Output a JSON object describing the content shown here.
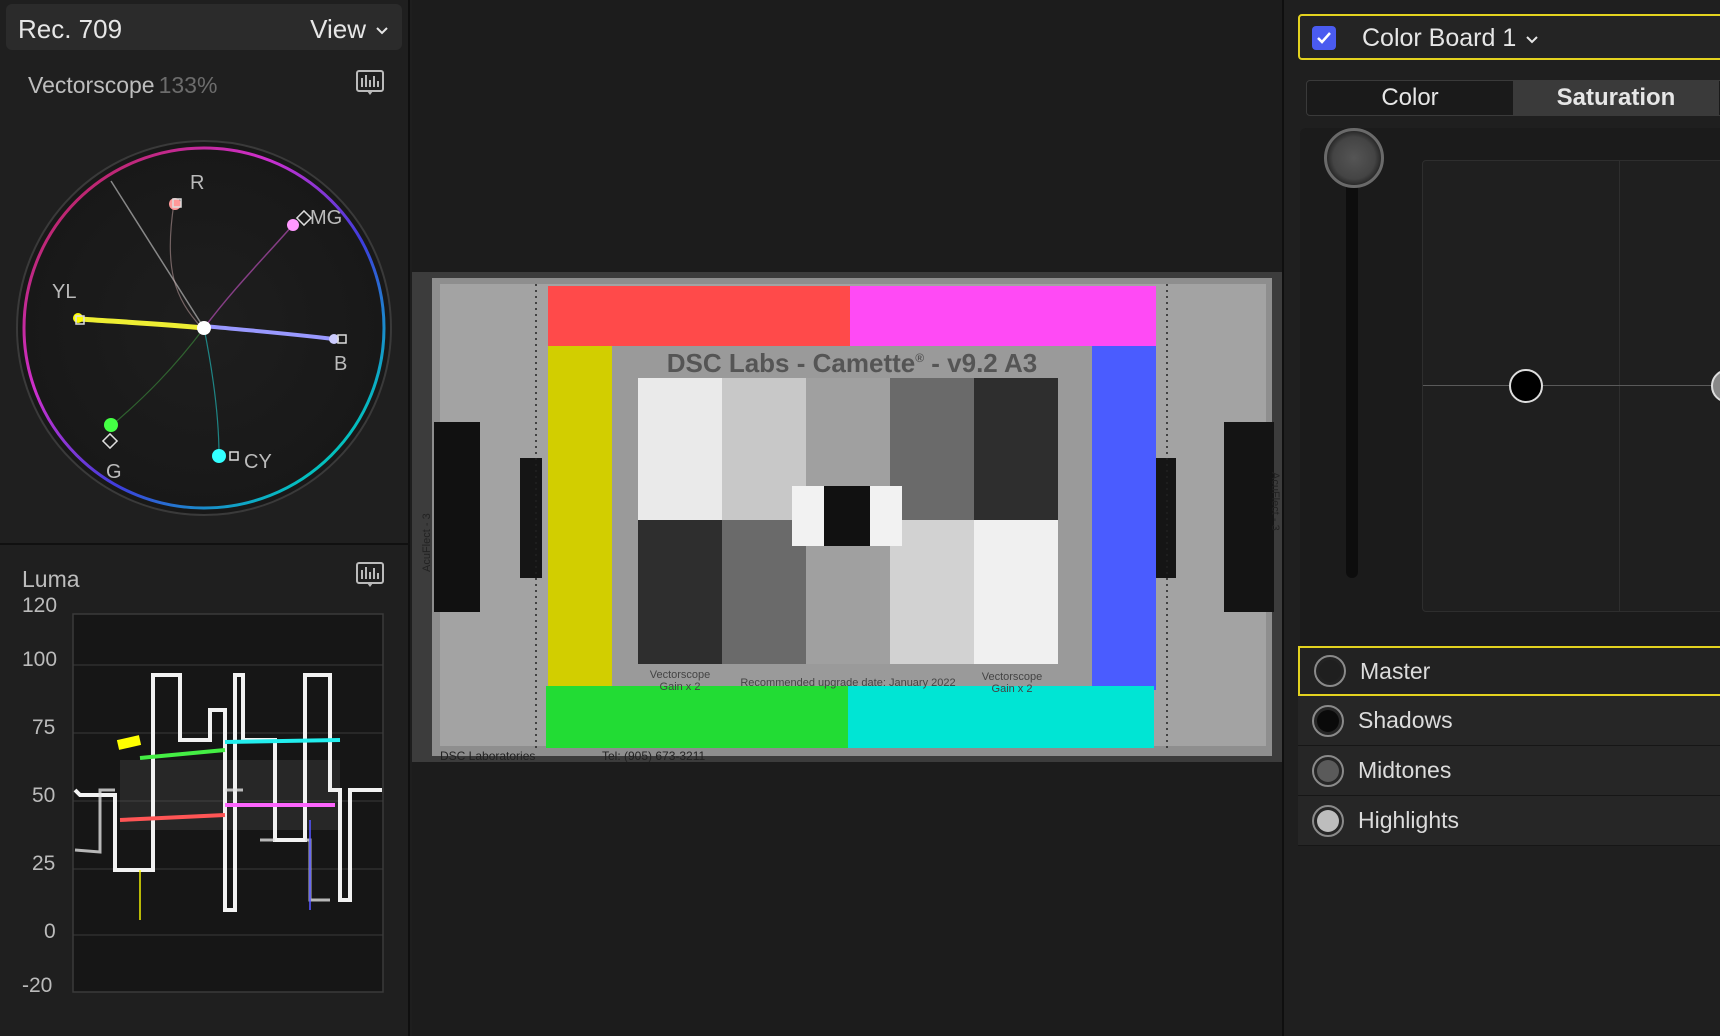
{
  "scopes": {
    "format": "Rec. 709",
    "view_menu": "View",
    "vectorscope": {
      "title": "Vectorscope",
      "zoom": "133%",
      "targets": [
        "R",
        "MG",
        "B",
        "CY",
        "G",
        "YL"
      ]
    },
    "luma": {
      "title": "Luma",
      "scale": [
        "120",
        "100",
        "75",
        "50",
        "25",
        "0",
        "-20"
      ]
    }
  },
  "viewer": {
    "chart_title": "DSC Labs - Camette",
    "chart_title_sup": "®",
    "chart_version": " - v9.2 A3",
    "side_label": "AcuFlect - 3",
    "left_caption_1": "Vectorscope",
    "left_caption_2": "Gain x 2",
    "right_caption_1": "Vectorscope",
    "right_caption_2": "Gain x 2",
    "upgrade_note": "Recommended upgrade date: January 2022",
    "footer_left": "DSC Laboratories",
    "footer_right": "Tel: (905) 673-3211",
    "colors": {
      "red": "#ff4a4a",
      "magenta": "#ff4af5",
      "yellow": "#d2ce00",
      "blue": "#4a5cff",
      "green": "#22dc34",
      "cyan": "#00e5d4"
    }
  },
  "inspector": {
    "board_title": "Color Board 1",
    "board_enabled": true,
    "tabs": [
      {
        "label": "Color",
        "active": false
      },
      {
        "label": "Saturation",
        "active": true
      }
    ],
    "ranges": [
      {
        "label": "Master",
        "selected": true,
        "fill": "#1f1f1f"
      },
      {
        "label": "Shadows",
        "selected": false,
        "fill": "#0a0a0a"
      },
      {
        "label": "Midtones",
        "selected": false,
        "fill": "#5a5a5a"
      },
      {
        "label": "Highlights",
        "selected": false,
        "fill": "#bdbdbd"
      }
    ]
  }
}
